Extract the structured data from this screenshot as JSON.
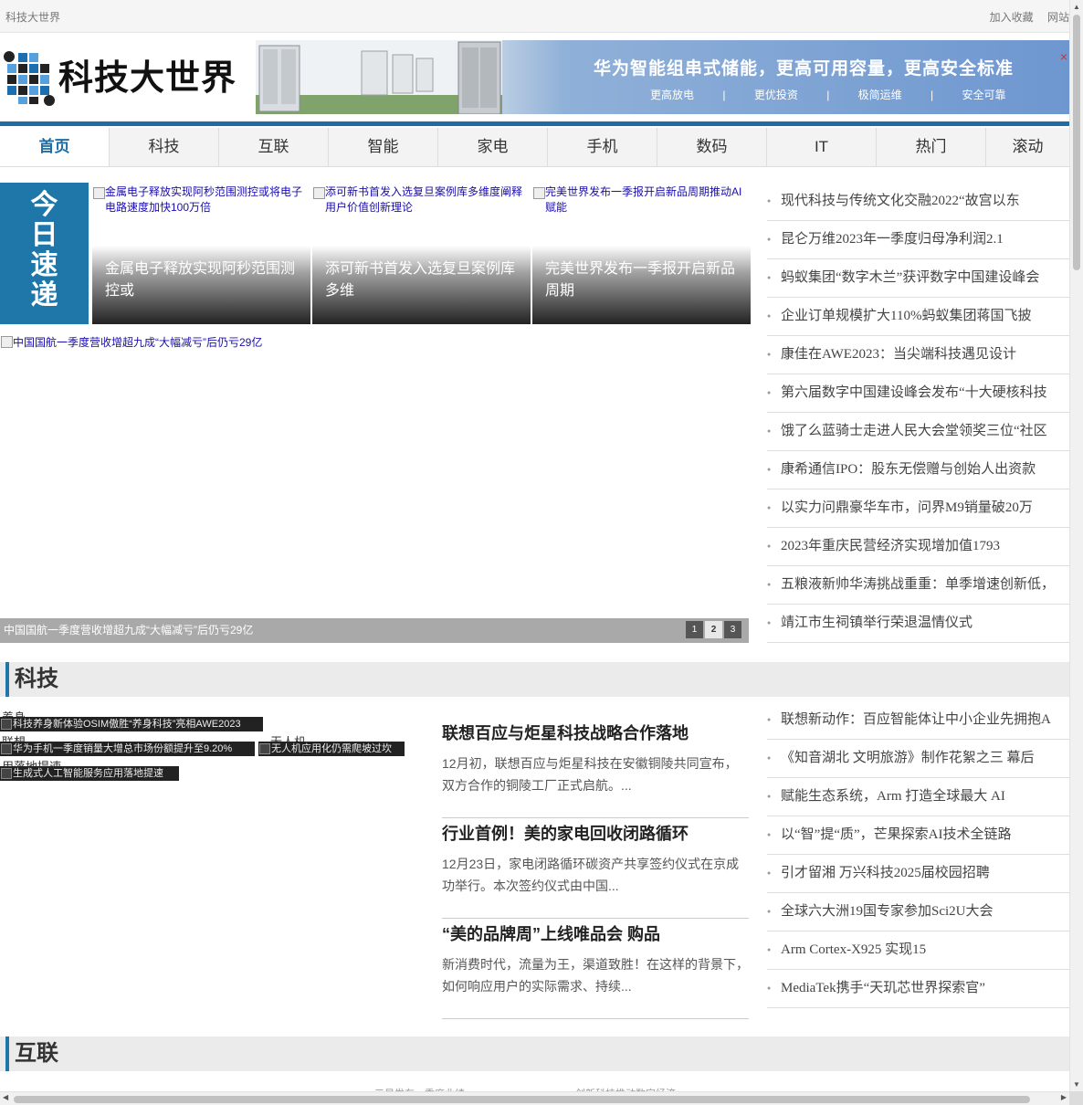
{
  "topbar": {
    "site_name": "科技大世界",
    "links": [
      "加入收藏",
      "网站"
    ]
  },
  "logo": {
    "text": "科技大世界"
  },
  "banner": {
    "title": "华为智能组串式储能，更高可用容量，更高安全标准",
    "features": [
      "更高放电",
      "|",
      "更优投资",
      "|",
      "极简运维",
      "|",
      "安全可靠"
    ],
    "close_glyph": "×"
  },
  "nav": {
    "items": [
      "首页",
      "科技",
      "互联",
      "智能",
      "家电",
      "手机",
      "数码",
      "IT",
      "热门",
      "滚动"
    ]
  },
  "today": {
    "label": "今日速递",
    "chars": [
      "今",
      "日",
      "速",
      "递"
    ]
  },
  "quick": [
    {
      "alt": "金属电子释放实现阿秒范围测控或将电子电路速度加快100万倍",
      "caption": "金属电子释放实现阿秒范围测控或"
    },
    {
      "alt": "添可新书首发入选复旦案例库多维度阐释用户价值创新理论",
      "caption": "添可新书首发入选复旦案例库多维"
    },
    {
      "alt": "完美世界发布一季报开启新品周期推动AI赋能",
      "caption": "完美世界发布一季报开启新品周期"
    }
  ],
  "slider": {
    "alt": "中国国航一季度营收增超九成“大幅减亏”后仍亏29亿",
    "caption": "中国国航一季度营收增超九成“大幅减亏”后仍亏29亿",
    "pages": [
      "1",
      "2",
      "3"
    ],
    "active_page": "2"
  },
  "top_list": [
    "现代科技与传统文化交融2022“故宫以东",
    "昆仑万维2023年一季度归母净利润2.1",
    "蚂蚁集团“数字木兰”获评数字中国建设峰会",
    "企业订单规模扩大110%蚂蚁集团蒋国飞披",
    "康佳在AWE2023：当尖端科技遇见设计",
    "第六届数字中国建设峰会发布“十大硬核科技",
    "饿了么蓝骑士走进人民大会堂领奖三位“社区",
    "康希通信IPO：股东无偿赠与创始人出资款",
    "以实力问鼎豪华车市，问界M9销量破20万",
    "2023年重庆民营经济实现增加值1793",
    "五粮液新帅华涛挑战重重：单季增速创新低，",
    "靖江市生祠镇举行荣退温情仪式"
  ],
  "keji": {
    "title": "科技",
    "images": [
      {
        "alt": "科技养身新体验OSIM傲胜“养身科技”亮相AWE2023",
        "over": "养身..."
      },
      {
        "alt": "华为手机一季度销量大增总市场份额提升至9.20%",
        "over": "联想..."
      },
      {
        "alt": "无人机应用化仍需爬坡过坎",
        "over": "无人机..."
      },
      {
        "alt": "生成式人工智能服务应用落地提速",
        "over": "用落地提速"
      }
    ],
    "articles": [
      {
        "title": "联想百应与炬星科技战略合作落地",
        "summary": "12月初，联想百应与炬星科技在安徽铜陵共同宣布，双方合作的铜陵工厂正式启航。..."
      },
      {
        "title": "行业首例！美的家电回收闭路循环",
        "summary": "12月23日，家电闭路循环碳资产共享签约仪式在京成功举行。本次签约仪式由中国..."
      },
      {
        "title": "“美的品牌周”上线唯品会 购品",
        "summary": "新消费时代，流量为王，渠道致胜！在这样的背景下，如何响应用户的实际需求、持续..."
      }
    ],
    "list": [
      "联想新动作：百应智能体让中小企业先拥抱A",
      "《知音湖北 文明旅游》制作花絮之三 幕后",
      "赋能生态系统，Arm 打造全球最大 AI",
      "以“智”提“质”，芒果探索AI技术全链路",
      "引才留湘 万兴科技2025届校园招聘",
      "全球六大洲19国专家参加Sci2U大会",
      "Arm Cortex-X925 实现15",
      "MediaTek携手“天玑芯世界探索官”"
    ]
  },
  "hulian": {
    "title": "互联",
    "alts": [
      "三星发布一季度业绩",
      "创新科技推动数字经济"
    ]
  }
}
